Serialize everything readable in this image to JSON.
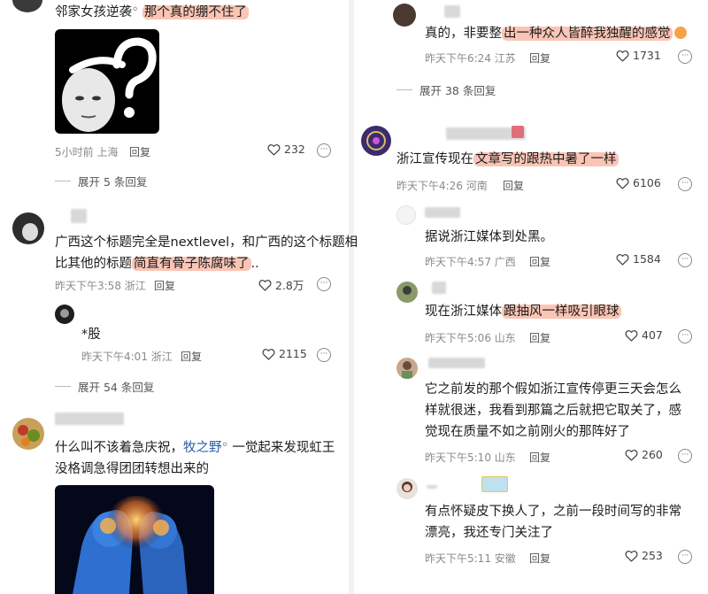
{
  "left": {
    "c1": {
      "text_before": "邻家女孩逆袭",
      "text_hl": "那个真的绷不住了",
      "time": "5小时前",
      "location": "上海",
      "reply": "回复",
      "likes": "232",
      "expand": "展开 5 条回复"
    },
    "c2": {
      "line1": "广西这个标题完全是nextlevel，和广西的这个标题相",
      "line2_before": "比其他的标题",
      "line2_hl": "简直有骨子陈腐味了",
      "line2_after": "..",
      "time": "昨天下午3:58",
      "location": "浙江",
      "reply": "回复",
      "likes": "2.8万"
    },
    "c3": {
      "text": "*股",
      "time": "昨天下午4:01",
      "location": "浙江",
      "reply": "回复",
      "likes": "2115",
      "expand": "展开 54 条回复"
    },
    "c4": {
      "line1_before": "什么叫不该着急庆祝，",
      "line1_link": "牧之野",
      "line1_after": "一觉起来发现虹王",
      "line2": "没格调急得团团转想出来的"
    }
  },
  "right": {
    "c1": {
      "text_before": "真的，非要整",
      "text_hl": "出一种众人皆醉我独醒的感觉",
      "time": "昨天下午6:24",
      "location": "江苏",
      "reply": "回复",
      "likes": "1731",
      "expand": "展开 38 条回复"
    },
    "c2": {
      "text_before": "浙江宣传现在",
      "text_hl": "文章写的跟热中暑了一样",
      "time": "昨天下午4:26",
      "location": "河南",
      "reply": "回复",
      "likes": "6106"
    },
    "c3": {
      "text": "据说浙江媒体到处黑。",
      "time": "昨天下午4:57",
      "location": "广西",
      "reply": "回复",
      "likes": "1584"
    },
    "c4": {
      "text_before": "现在浙江媒体",
      "text_hl": "跟抽风一样吸引眼球",
      "time": "昨天下午5:06",
      "location": "山东",
      "reply": "回复",
      "likes": "407"
    },
    "c5": {
      "line1": "它之前发的那个假如浙江宣传停更三天会怎么",
      "line2": "样就很迷，我看到那篇之后就把它取关了，感",
      "line3": "觉现在质量不如之前刚火的那阵好了",
      "time": "昨天下午5:10",
      "location": "山东",
      "reply": "回复",
      "likes": "260"
    },
    "c6": {
      "line1": "有点怀疑皮下换人了，之前一段时间写的非常",
      "line2": "漂亮，我还专门关注了",
      "time": "昨天下午5:11",
      "location": "安徽",
      "reply": "回复",
      "likes": "253"
    }
  },
  "colors": {
    "highlight": "#f5a58a",
    "link": "#2a5aa8",
    "meta": "#8a8a8a"
  }
}
